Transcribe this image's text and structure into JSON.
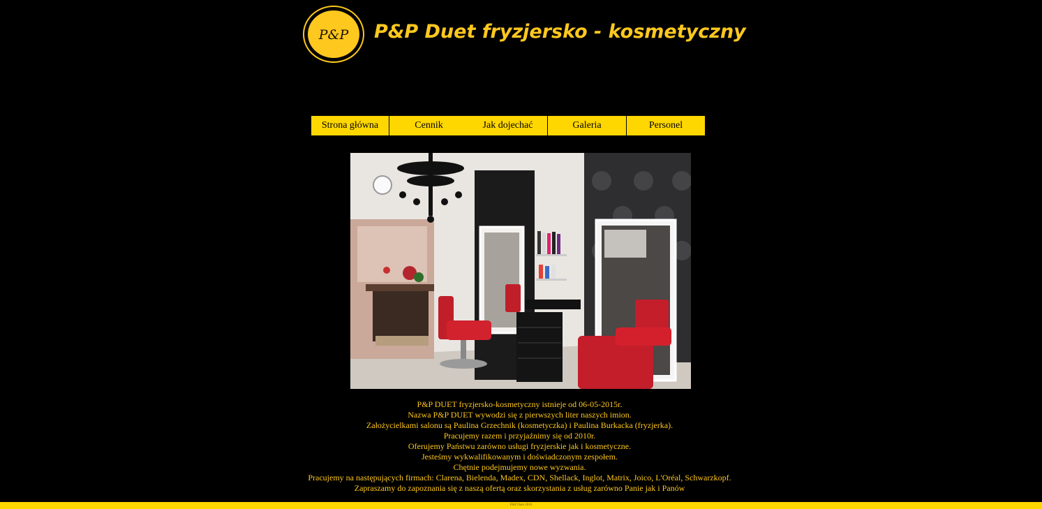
{
  "header": {
    "logo_text": "P&P",
    "title": "P&P Duet fryzjersko - kosmetyczny"
  },
  "nav": {
    "items": [
      {
        "label": "Strona główna"
      },
      {
        "label": "Cennik"
      },
      {
        "label": "Jak dojechać"
      },
      {
        "label": "Galeria"
      },
      {
        "label": "Personel"
      }
    ]
  },
  "photo": {
    "description_icon": "salon-interior-image"
  },
  "content": {
    "lines": [
      "P&P DUET fryzjersko-kosmetyczny istnieje od 06-05-2015r.",
      "Nazwa P&P DUET wywodzi się z pierwszych liter naszych imion.",
      "Założycielkami salonu są Paulina Grzechnik (kosmetyczka) i Paulina Burkacka (fryzjerka).",
      "Pracujemy razem i przyjaźnimy się od 2010r.",
      "Oferujemy Państwu zarówno usługi fryzjerskie jak i kosmetyczne.",
      "Jesteśmy wykwalifikowanym i doświadczonym zespołem.",
      "Chętnie podejmujemy nowe wyzwania.",
      "Pracujemy na następujących firmach: Clarena, Bielenda, Madex, CDN, Shellack, Inglot, Matrix, Joico, L'Oréal, Schwarzkopf.",
      "Zapraszamy do zapoznania się z naszą ofertą oraz skorzystania z usług zarówno Panie jak i Panów"
    ]
  },
  "footer": {
    "text": "P&P Duet 2016"
  },
  "colors": {
    "background": "#000000",
    "accent": "#FFD700",
    "text_gold": "#FFC81E"
  }
}
